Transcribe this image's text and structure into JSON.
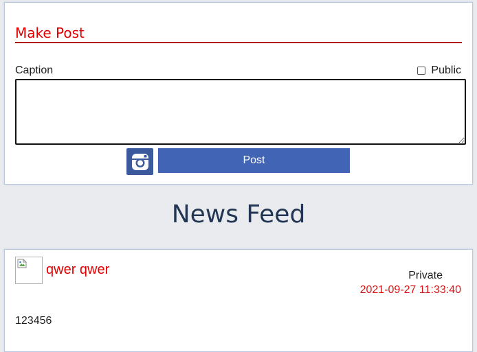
{
  "make_post": {
    "title": "Make Post",
    "caption_label": "Caption",
    "public_label": "Public",
    "public_checked": false,
    "caption_value": "",
    "instagram_icon": "instagram-icon",
    "post_button_label": "Post"
  },
  "feed": {
    "heading": "News Feed",
    "posts": [
      {
        "author": "qwer qwer",
        "visibility": "Private",
        "timestamp": "2021-09-27 11:33:40",
        "body": "123456"
      }
    ]
  },
  "colors": {
    "accent_red": "#e00000",
    "primary_blue": "#4164b4",
    "heading_navy": "#223654",
    "background": "#e9ebee"
  }
}
